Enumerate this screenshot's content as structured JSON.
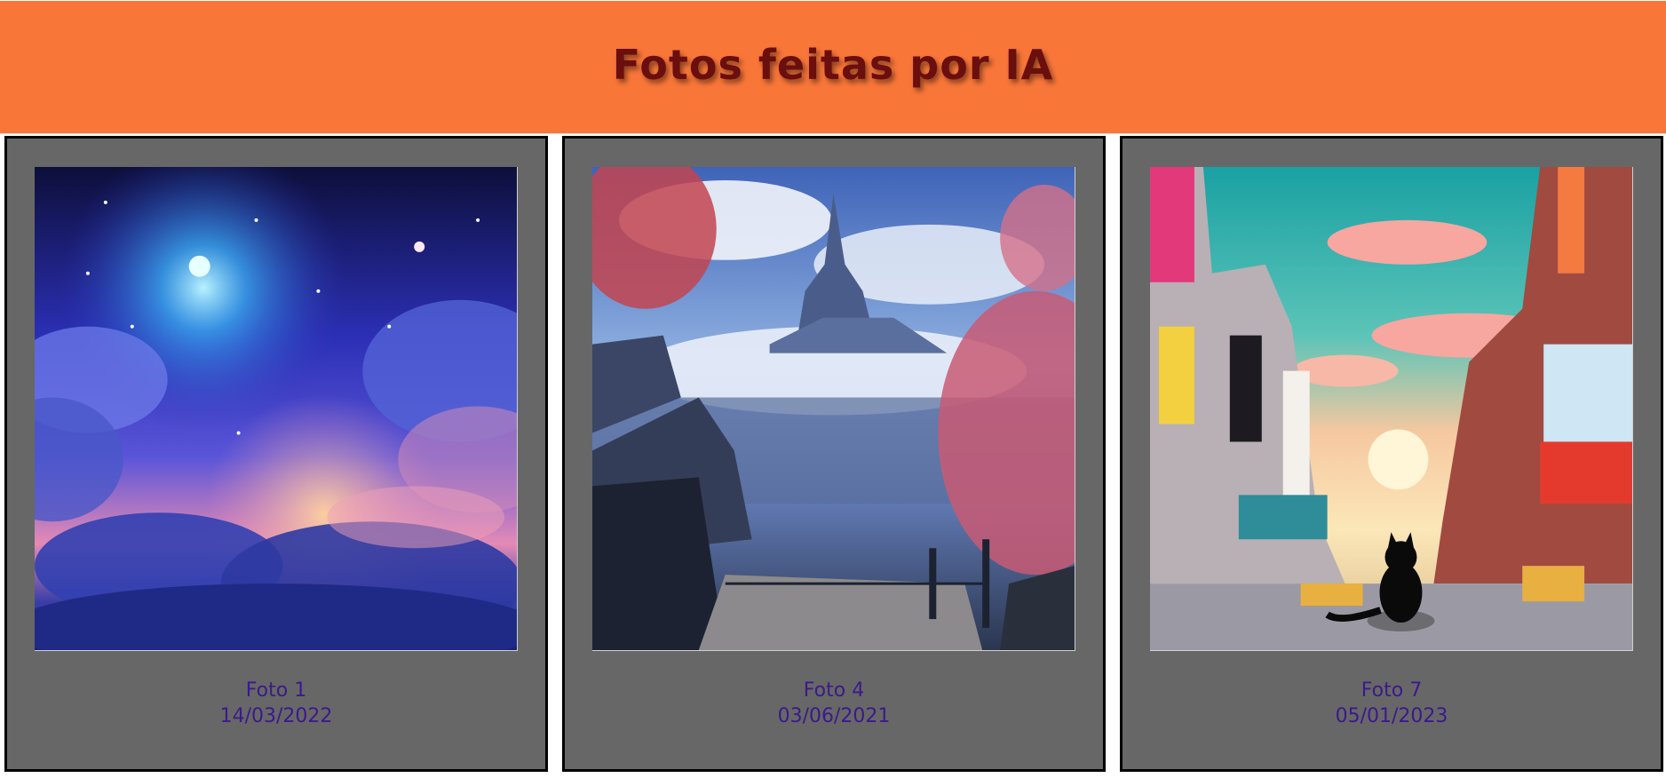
{
  "header": {
    "title": "Fotos feitas por IA",
    "background": "#f97639",
    "title_color": "#6b0e0e"
  },
  "gallery": {
    "card_background": "#676767",
    "caption_color": "#3b1a8a",
    "cards": [
      {
        "label": "Foto 1",
        "date": "14/03/2022",
        "image": "starry-sky-clouds-image"
      },
      {
        "label": "Foto 4",
        "date": "03/06/2021",
        "image": "fantasy-castle-cherry-trees-image"
      },
      {
        "label": "Foto 7",
        "date": "05/01/2023",
        "image": "city-street-black-cat-image"
      }
    ]
  }
}
